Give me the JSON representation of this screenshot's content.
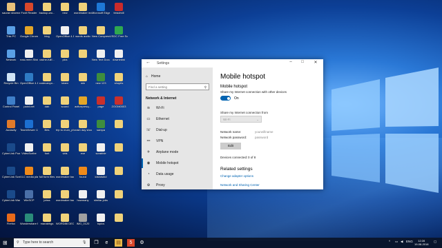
{
  "desktop_icons": [
    {
      "label": "saurav sharma",
      "color": "#e8c07a"
    },
    {
      "label": "Foxit Reader",
      "color": "#d9472b"
    },
    {
      "label": "backup-wo...",
      "color": "#f0d27a"
    },
    {
      "label": "new",
      "color": "#f0d27a"
    },
    {
      "label": "wordmaker modified",
      "color": "#f0d27a"
    },
    {
      "label": "Microsoft Edge",
      "color": "#1e78d7"
    },
    {
      "label": "treadmill",
      "color": "#c92b2b"
    },
    {
      "label": "This PC",
      "color": "#5aa0e6"
    },
    {
      "label": "Google Chrome",
      "color": "#e4a628"
    },
    {
      "label": "blog",
      "color": "#f0d27a"
    },
    {
      "label": "OpenOffice 4.1.5 (en-G...",
      "color": "#f0f0f0"
    },
    {
      "label": "words audio",
      "color": "#f0d27a"
    },
    {
      "label": "New Compress...",
      "color": "#f0d27a"
    },
    {
      "label": "VSDC Free Screen Rec...",
      "color": "#2fa84f"
    },
    {
      "label": "Network",
      "color": "#5aa0e6"
    },
    {
      "label": "rcss.reem Slideshi...",
      "color": "#f0f0f0"
    },
    {
      "label": "cache-fullf...",
      "color": "#f0d27a"
    },
    {
      "label": "pics",
      "color": "#f0d27a"
    },
    {
      "label": "",
      "color": "#f0d27a"
    },
    {
      "label": "New Text Document",
      "color": "#f0f0f0"
    },
    {
      "label": "downedwi",
      "color": "#f0f0f0"
    },
    {
      "label": "Recycle Bin",
      "color": "#cfe3f5"
    },
    {
      "label": "OpenOffice 4.1.5",
      "color": "#2f7bc4"
    },
    {
      "label": "codecanyo...",
      "color": "#f0d27a"
    },
    {
      "label": "lotam",
      "color": "#f0d27a"
    },
    {
      "label": "min",
      "color": "#f0d27a"
    },
    {
      "label": "new 123",
      "color": "#3e8d3e"
    },
    {
      "label": "shopits",
      "color": "#f0d27a"
    },
    {
      "label": "Control Panel",
      "color": "#3f7fc9"
    },
    {
      "label": "paint.net",
      "color": "#f0f0f0"
    },
    {
      "label": "dab",
      "color": "#f0d27a"
    },
    {
      "label": "sound",
      "color": "#f0d27a"
    },
    {
      "label": "activepresq...",
      "color": "#e4a628"
    },
    {
      "label": "page",
      "color": "#c9302c"
    },
    {
      "label": "ZOOM0003",
      "color": "#c9302c"
    },
    {
      "label": "Audacity",
      "color": "#e07a2a"
    },
    {
      "label": "TeamViewer 13",
      "color": "#1c6fd1"
    },
    {
      "label": "files",
      "color": "#f0d27a"
    },
    {
      "label": "trip to mum_photo...",
      "color": "#f0d27a"
    },
    {
      "label": "crash day shocks",
      "color": "#f0d27a"
    },
    {
      "label": "sampa",
      "color": "#3e8d3e"
    },
    {
      "label": "",
      "color": "#f0d27a"
    },
    {
      "label": "CyberLink PowerDirec...",
      "color": "#1a4a8a"
    },
    {
      "label": "VideoScribe",
      "color": "#f0f0f0"
    },
    {
      "label": "font",
      "color": "#f0d27a"
    },
    {
      "label": "vids",
      "color": "#f0d27a"
    },
    {
      "label": "exe",
      "color": "#f0d27a"
    },
    {
      "label": "scrabble",
      "color": "#f0f0f0"
    },
    {
      "label": "",
      "color": "#f0d27a"
    },
    {
      "label": "CyberLink Screen Re...",
      "color": "#1a4a8a"
    },
    {
      "label": "VLC media player",
      "color": "#f08a1a"
    },
    {
      "label": "full form files",
      "color": "#f0d27a"
    },
    {
      "label": "wordmaker backup gam...",
      "color": "#f0d27a"
    },
    {
      "label": "found",
      "color": "#f08a1a"
    },
    {
      "label": "idsbdsbid",
      "color": "#f0f0f0"
    },
    {
      "label": "",
      "color": "#f0d27a"
    },
    {
      "label": "CyberLink WaveEditor 2",
      "color": "#1a4a8a"
    },
    {
      "label": "WinSCP",
      "color": "#4a6fa8"
    },
    {
      "label": "jobss",
      "color": "#f0d27a"
    },
    {
      "label": "wordmaker backup b...",
      "color": "#f0d27a"
    },
    {
      "label": "howmany",
      "color": "#f0f0f0"
    },
    {
      "label": "similar jobs",
      "color": "#f0f0f0"
    },
    {
      "label": "",
      "color": "#f0d27a"
    },
    {
      "label": "Firefox",
      "color": "#e86a1a"
    },
    {
      "label": "Wondershare Filmora",
      "color": "#2a8c7a"
    },
    {
      "label": "manabhgs",
      "color": "#f0d27a"
    },
    {
      "label": "WORD86 DEC BACK",
      "color": "#f0d27a"
    },
    {
      "label": "IMG_0120",
      "color": "#a0a0a0"
    },
    {
      "label": "topics",
      "color": "#f0f0f0"
    },
    {
      "label": "",
      "color": "#f0d27a"
    }
  ],
  "window": {
    "title": "Settings",
    "back_icon": "back-arrow-icon",
    "minimize": "–",
    "maximize": "□",
    "close": "✕"
  },
  "sidebar": {
    "home": "Home",
    "search_placeholder": "Find a setting",
    "category": "Network & Internet",
    "items": [
      {
        "label": "Wi-Fi",
        "icon": "wifi-icon",
        "glyph": "≋"
      },
      {
        "label": "Ethernet",
        "icon": "ethernet-icon",
        "glyph": "▭"
      },
      {
        "label": "Dial-up",
        "icon": "phone-icon",
        "glyph": "☏"
      },
      {
        "label": "VPN",
        "icon": "vpn-icon",
        "glyph": "⚯"
      },
      {
        "label": "Airplane mode",
        "icon": "airplane-icon",
        "glyph": "✈"
      },
      {
        "label": "Mobile hotspot",
        "icon": "hotspot-icon",
        "glyph": "◉"
      },
      {
        "label": "Data usage",
        "icon": "data-usage-icon",
        "glyph": "◔"
      },
      {
        "label": "Proxy",
        "icon": "proxy-icon",
        "glyph": "⊕"
      }
    ],
    "active_index": 5
  },
  "main": {
    "title": "Mobile hotspot",
    "section": "Mobile hotspot",
    "description": "Share my Internet connection with other devices",
    "toggle_state": "On",
    "share_label": "Share my Internet connection from",
    "share_value": "Wi-Fi",
    "network_name_label": "Network name:",
    "network_name_value": "yourwifiname",
    "network_password_label": "Network password:",
    "network_password_value": "password",
    "edit_label": "Edit",
    "devices_label": "Devices connected:",
    "devices_value": "0 of 8",
    "related_heading": "Related settings",
    "related_links": [
      "Change adapter options",
      "Network and Sharing Center"
    ]
  },
  "taskbar": {
    "search_placeholder": "Type here to search",
    "language": "ENG",
    "time": "12:28",
    "date": "19-08-2018"
  },
  "colors": {
    "accent": "#0063b1",
    "sidebar_bg": "#e6e6e6"
  }
}
